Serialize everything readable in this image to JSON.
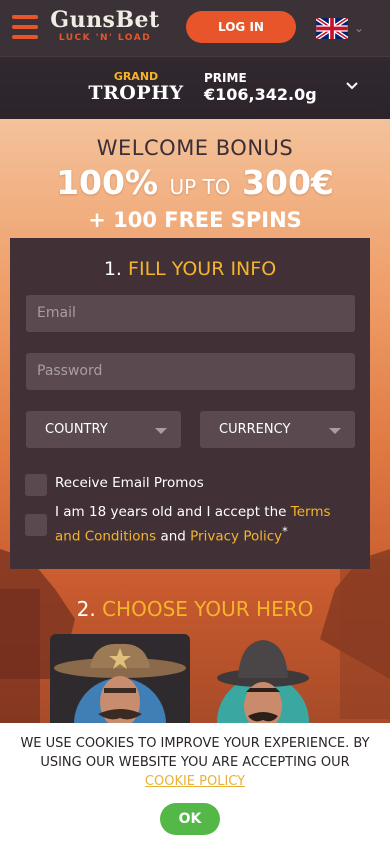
{
  "header": {
    "logo_main": "GunsBet",
    "logo_sub": "LUCK 'N' LOAD",
    "login_label": "LOG IN",
    "language_flag": "uk-flag-icon"
  },
  "jackpot": {
    "brand_top": "GRAND",
    "brand_bottom": "TROPHY",
    "prime_label": "PRIME",
    "prime_value": "€106,342.0g"
  },
  "welcome": {
    "title": "WELCOME BONUS",
    "percent": "100%",
    "up_to": "UP TO",
    "amount": "300€",
    "spins": "+ 100 FREE SPINS"
  },
  "form": {
    "step_number": "1.",
    "step_title": "FILL YOUR INFO",
    "email_placeholder": "Email",
    "password_placeholder": "Password",
    "country_label": "COUNTRY",
    "currency_label": "CURRENCY",
    "promo_label": "Receive Email Promos",
    "terms_prefix": "I am 18 years old and I accept the",
    "terms_link": "Terms and Conditions",
    "terms_and": "and",
    "privacy_link": "Privacy Policy",
    "terms_suffix": "*"
  },
  "hero": {
    "step_number": "2.",
    "step_title": "CHOOSE YOUR HERO"
  },
  "cookie": {
    "text": "WE USE COOKIES TO IMPROVE YOUR EXPERIENCE. BY USING OUR WEBSITE YOU ARE ACCEPTING OUR",
    "link": "COOKIE POLICY",
    "ok_label": "OK"
  },
  "colors": {
    "accent": "#e8552a",
    "gold": "#f4b42b",
    "ok_green": "#54b848"
  }
}
